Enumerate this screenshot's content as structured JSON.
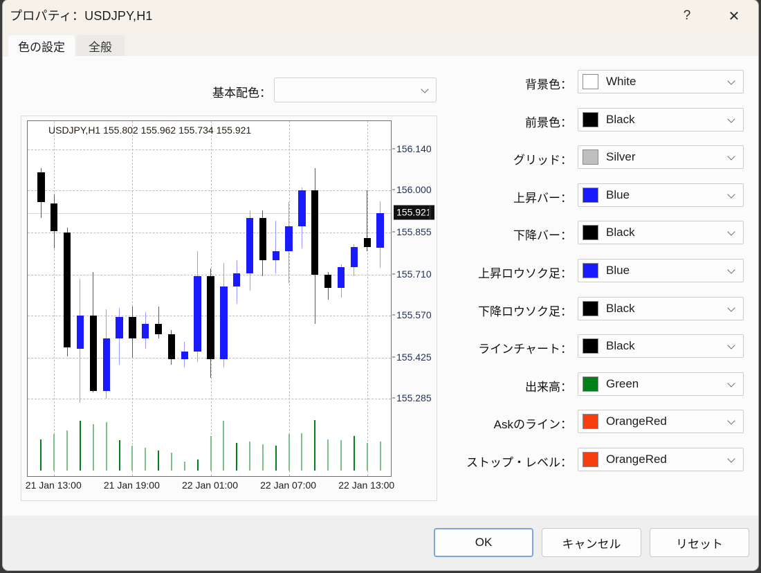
{
  "window": {
    "title": "プロパティ：USDJPY,H1",
    "help_icon": "question-mark-icon",
    "close_icon": "close-icon"
  },
  "tabs": [
    {
      "label": "色の設定",
      "active": true
    },
    {
      "label": "全般",
      "active": false
    }
  ],
  "scheme": {
    "label": "基本配色：",
    "value": "",
    "placeholder": ""
  },
  "color_rows": [
    {
      "label": "背景色：",
      "name": "White",
      "hex": "#ffffff"
    },
    {
      "label": "前景色：",
      "name": "Black",
      "hex": "#000000"
    },
    {
      "label": "グリッド：",
      "name": "Silver",
      "hex": "#bfbfbf"
    },
    {
      "label": "上昇バー：",
      "name": "Blue",
      "hex": "#1a1aff"
    },
    {
      "label": "下降バー：",
      "name": "Black",
      "hex": "#000000"
    },
    {
      "label": "上昇ロウソク足：",
      "name": "Blue",
      "hex": "#1a1aff"
    },
    {
      "label": "下降ロウソク足：",
      "name": "Black",
      "hex": "#000000"
    },
    {
      "label": "ラインチャート：",
      "name": "Black",
      "hex": "#000000"
    },
    {
      "label": "出来高：",
      "name": "Green",
      "hex": "#00801b"
    },
    {
      "label": "Askのライン：",
      "name": "OrangeRed",
      "hex": "#f53d10"
    },
    {
      "label": "ストップ・レベル：",
      "name": "OrangeRed",
      "hex": "#f53d10"
    }
  ],
  "footer": {
    "ok": "OK",
    "cancel": "キャンセル",
    "reset": "リセット"
  },
  "chart_data": {
    "type": "candlestick",
    "title": "USDJPY,H1  155.802 155.962 155.734 155.921",
    "symbol": "USDJPY",
    "timeframe": "H1",
    "quote_open": "155.802",
    "quote_high": "155.962",
    "quote_low": "155.734",
    "quote_close": "155.921",
    "current_price": "155.921",
    "xlabel": "",
    "ylabel": "",
    "grid": true,
    "ylim": [
      155.215,
      156.18
    ],
    "ytick_labels": [
      "156.140",
      "156.000",
      "155.855",
      "155.710",
      "155.570",
      "155.425",
      "155.285"
    ],
    "ytick_values": [
      156.14,
      156.0,
      155.855,
      155.71,
      155.57,
      155.425,
      155.285
    ],
    "xtick_labels": [
      "21 Jan 13:00",
      "21 Jan 19:00",
      "22 Jan 01:00",
      "22 Jan 07:00",
      "22 Jan 13:00"
    ],
    "xtick_indices": [
      1,
      7,
      13,
      19,
      25
    ],
    "up_color": "#1a1aff",
    "down_color": "#000000",
    "volume_color": "#00801b",
    "candles": [
      {
        "t": "21 Jan 12:00",
        "o": 156.06,
        "h": 156.075,
        "l": 155.905,
        "c": 155.96,
        "dir": "down",
        "v": 0.62
      },
      {
        "t": "21 Jan 13:00",
        "o": 155.955,
        "h": 155.985,
        "l": 155.8,
        "c": 155.86,
        "dir": "down",
        "v": 0.72
      },
      {
        "t": "21 Jan 14:00",
        "o": 155.855,
        "h": 155.87,
        "l": 155.43,
        "c": 155.46,
        "dir": "down",
        "v": 0.8
      },
      {
        "t": "21 Jan 15:00",
        "o": 155.455,
        "h": 155.695,
        "l": 155.27,
        "c": 155.57,
        "dir": "up",
        "v": 0.98
      },
      {
        "t": "21 Jan 16:00",
        "o": 155.57,
        "h": 155.72,
        "l": 155.305,
        "c": 155.31,
        "dir": "down",
        "v": 0.92
      },
      {
        "t": "21 Jan 17:00",
        "o": 155.31,
        "h": 155.59,
        "l": 155.285,
        "c": 155.49,
        "dir": "up",
        "v": 0.96
      },
      {
        "t": "21 Jan 18:00",
        "o": 155.49,
        "h": 155.595,
        "l": 155.4,
        "c": 155.565,
        "dir": "up",
        "v": 0.6
      },
      {
        "t": "21 Jan 19:00",
        "o": 155.565,
        "h": 155.6,
        "l": 155.425,
        "c": 155.49,
        "dir": "down",
        "v": 0.5
      },
      {
        "t": "21 Jan 20:00",
        "o": 155.49,
        "h": 155.58,
        "l": 155.455,
        "c": 155.54,
        "dir": "up",
        "v": 0.45
      },
      {
        "t": "21 Jan 21:00",
        "o": 155.54,
        "h": 155.6,
        "l": 155.49,
        "c": 155.505,
        "dir": "down",
        "v": 0.4
      },
      {
        "t": "21 Jan 22:00",
        "o": 155.505,
        "h": 155.52,
        "l": 155.4,
        "c": 155.42,
        "dir": "down",
        "v": 0.35
      },
      {
        "t": "21 Jan 23:00",
        "o": 155.42,
        "h": 155.48,
        "l": 155.39,
        "c": 155.445,
        "dir": "up",
        "v": 0.18
      },
      {
        "t": "22 Jan 00:00",
        "o": 155.445,
        "h": 155.79,
        "l": 155.41,
        "c": 155.705,
        "dir": "up",
        "v": 0.22
      },
      {
        "t": "22 Jan 01:00",
        "o": 155.705,
        "h": 155.73,
        "l": 155.355,
        "c": 155.42,
        "dir": "down",
        "v": 0.68
      },
      {
        "t": "22 Jan 02:00",
        "o": 155.42,
        "h": 155.75,
        "l": 155.39,
        "c": 155.67,
        "dir": "up",
        "v": 0.98
      },
      {
        "t": "22 Jan 03:00",
        "o": 155.67,
        "h": 155.76,
        "l": 155.61,
        "c": 155.715,
        "dir": "up",
        "v": 0.55
      },
      {
        "t": "22 Jan 04:00",
        "o": 155.715,
        "h": 155.93,
        "l": 155.655,
        "c": 155.905,
        "dir": "up",
        "v": 0.58
      },
      {
        "t": "22 Jan 05:00",
        "o": 155.905,
        "h": 155.93,
        "l": 155.705,
        "c": 155.76,
        "dir": "down",
        "v": 0.52
      },
      {
        "t": "22 Jan 06:00",
        "o": 155.76,
        "h": 155.895,
        "l": 155.715,
        "c": 155.79,
        "dir": "up",
        "v": 0.5
      },
      {
        "t": "22 Jan 07:00",
        "o": 155.79,
        "h": 155.96,
        "l": 155.68,
        "c": 155.875,
        "dir": "up",
        "v": 0.72
      },
      {
        "t": "22 Jan 08:00",
        "o": 155.875,
        "h": 156.01,
        "l": 155.8,
        "c": 156.0,
        "dir": "up",
        "v": 0.74
      },
      {
        "t": "22 Jan 09:00",
        "o": 156.0,
        "h": 156.075,
        "l": 155.54,
        "c": 155.71,
        "dir": "down",
        "v": 1.0
      },
      {
        "t": "22 Jan 10:00",
        "o": 155.71,
        "h": 155.72,
        "l": 155.625,
        "c": 155.665,
        "dir": "down",
        "v": 0.62
      },
      {
        "t": "22 Jan 11:00",
        "o": 155.665,
        "h": 155.745,
        "l": 155.63,
        "c": 155.735,
        "dir": "up",
        "v": 0.6
      },
      {
        "t": "22 Jan 12:00",
        "o": 155.735,
        "h": 155.815,
        "l": 155.705,
        "c": 155.805,
        "dir": "up",
        "v": 0.68
      },
      {
        "t": "22 Jan 13:00",
        "o": 155.805,
        "h": 156.0,
        "l": 155.79,
        "c": 155.835,
        "dir": "down",
        "v": 0.55
      },
      {
        "t": "22 Jan 14:00",
        "o": 155.802,
        "h": 155.962,
        "l": 155.734,
        "c": 155.921,
        "dir": "up",
        "v": 0.58
      }
    ],
    "volume_bars": [
      0.62,
      0.72,
      0.8,
      0.98,
      0.92,
      0.96,
      0.6,
      0.5,
      0.45,
      0.4,
      0.35,
      0.18,
      0.22,
      0.68,
      0.98,
      0.55,
      0.58,
      0.52,
      0.5,
      0.72,
      0.74,
      1.0,
      0.62,
      0.6,
      0.68,
      0.55,
      0.58
    ]
  }
}
